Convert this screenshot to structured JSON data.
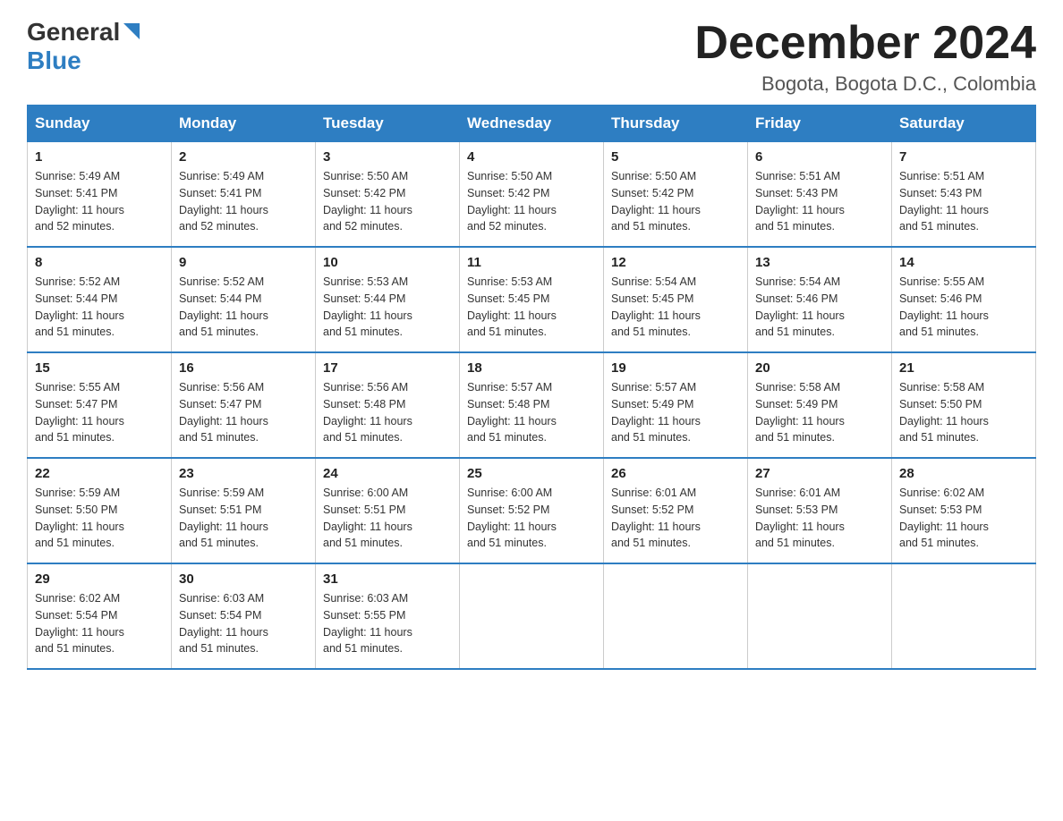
{
  "header": {
    "logo_general": "General",
    "logo_blue": "Blue",
    "month_title": "December 2024",
    "location": "Bogota, Bogota D.C., Colombia"
  },
  "days_of_week": [
    "Sunday",
    "Monday",
    "Tuesday",
    "Wednesday",
    "Thursday",
    "Friday",
    "Saturday"
  ],
  "weeks": [
    [
      {
        "num": "1",
        "sunrise": "5:49 AM",
        "sunset": "5:41 PM",
        "daylight": "11 hours and 52 minutes."
      },
      {
        "num": "2",
        "sunrise": "5:49 AM",
        "sunset": "5:41 PM",
        "daylight": "11 hours and 52 minutes."
      },
      {
        "num": "3",
        "sunrise": "5:50 AM",
        "sunset": "5:42 PM",
        "daylight": "11 hours and 52 minutes."
      },
      {
        "num": "4",
        "sunrise": "5:50 AM",
        "sunset": "5:42 PM",
        "daylight": "11 hours and 52 minutes."
      },
      {
        "num": "5",
        "sunrise": "5:50 AM",
        "sunset": "5:42 PM",
        "daylight": "11 hours and 51 minutes."
      },
      {
        "num": "6",
        "sunrise": "5:51 AM",
        "sunset": "5:43 PM",
        "daylight": "11 hours and 51 minutes."
      },
      {
        "num": "7",
        "sunrise": "5:51 AM",
        "sunset": "5:43 PM",
        "daylight": "11 hours and 51 minutes."
      }
    ],
    [
      {
        "num": "8",
        "sunrise": "5:52 AM",
        "sunset": "5:44 PM",
        "daylight": "11 hours and 51 minutes."
      },
      {
        "num": "9",
        "sunrise": "5:52 AM",
        "sunset": "5:44 PM",
        "daylight": "11 hours and 51 minutes."
      },
      {
        "num": "10",
        "sunrise": "5:53 AM",
        "sunset": "5:44 PM",
        "daylight": "11 hours and 51 minutes."
      },
      {
        "num": "11",
        "sunrise": "5:53 AM",
        "sunset": "5:45 PM",
        "daylight": "11 hours and 51 minutes."
      },
      {
        "num": "12",
        "sunrise": "5:54 AM",
        "sunset": "5:45 PM",
        "daylight": "11 hours and 51 minutes."
      },
      {
        "num": "13",
        "sunrise": "5:54 AM",
        "sunset": "5:46 PM",
        "daylight": "11 hours and 51 minutes."
      },
      {
        "num": "14",
        "sunrise": "5:55 AM",
        "sunset": "5:46 PM",
        "daylight": "11 hours and 51 minutes."
      }
    ],
    [
      {
        "num": "15",
        "sunrise": "5:55 AM",
        "sunset": "5:47 PM",
        "daylight": "11 hours and 51 minutes."
      },
      {
        "num": "16",
        "sunrise": "5:56 AM",
        "sunset": "5:47 PM",
        "daylight": "11 hours and 51 minutes."
      },
      {
        "num": "17",
        "sunrise": "5:56 AM",
        "sunset": "5:48 PM",
        "daylight": "11 hours and 51 minutes."
      },
      {
        "num": "18",
        "sunrise": "5:57 AM",
        "sunset": "5:48 PM",
        "daylight": "11 hours and 51 minutes."
      },
      {
        "num": "19",
        "sunrise": "5:57 AM",
        "sunset": "5:49 PM",
        "daylight": "11 hours and 51 minutes."
      },
      {
        "num": "20",
        "sunrise": "5:58 AM",
        "sunset": "5:49 PM",
        "daylight": "11 hours and 51 minutes."
      },
      {
        "num": "21",
        "sunrise": "5:58 AM",
        "sunset": "5:50 PM",
        "daylight": "11 hours and 51 minutes."
      }
    ],
    [
      {
        "num": "22",
        "sunrise": "5:59 AM",
        "sunset": "5:50 PM",
        "daylight": "11 hours and 51 minutes."
      },
      {
        "num": "23",
        "sunrise": "5:59 AM",
        "sunset": "5:51 PM",
        "daylight": "11 hours and 51 minutes."
      },
      {
        "num": "24",
        "sunrise": "6:00 AM",
        "sunset": "5:51 PM",
        "daylight": "11 hours and 51 minutes."
      },
      {
        "num": "25",
        "sunrise": "6:00 AM",
        "sunset": "5:52 PM",
        "daylight": "11 hours and 51 minutes."
      },
      {
        "num": "26",
        "sunrise": "6:01 AM",
        "sunset": "5:52 PM",
        "daylight": "11 hours and 51 minutes."
      },
      {
        "num": "27",
        "sunrise": "6:01 AM",
        "sunset": "5:53 PM",
        "daylight": "11 hours and 51 minutes."
      },
      {
        "num": "28",
        "sunrise": "6:02 AM",
        "sunset": "5:53 PM",
        "daylight": "11 hours and 51 minutes."
      }
    ],
    [
      {
        "num": "29",
        "sunrise": "6:02 AM",
        "sunset": "5:54 PM",
        "daylight": "11 hours and 51 minutes."
      },
      {
        "num": "30",
        "sunrise": "6:03 AM",
        "sunset": "5:54 PM",
        "daylight": "11 hours and 51 minutes."
      },
      {
        "num": "31",
        "sunrise": "6:03 AM",
        "sunset": "5:55 PM",
        "daylight": "11 hours and 51 minutes."
      },
      null,
      null,
      null,
      null
    ]
  ],
  "labels": {
    "sunrise": "Sunrise:",
    "sunset": "Sunset:",
    "daylight": "Daylight:"
  }
}
